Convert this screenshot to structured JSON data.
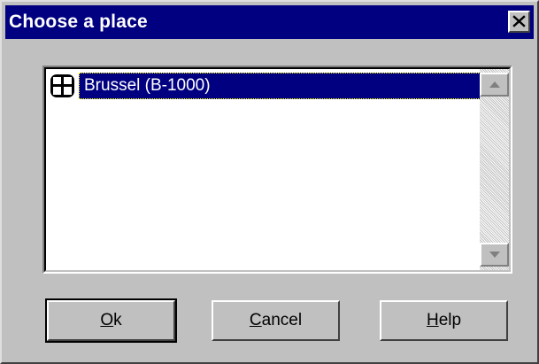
{
  "window": {
    "title": "Choose a place",
    "close_glyph": "✕"
  },
  "list": {
    "items": [
      {
        "label": "Brussel (B-1000)",
        "icon": "grid-place-icon",
        "selected": true
      }
    ]
  },
  "buttons": {
    "ok": {
      "mnemonic": "O",
      "rest": "k"
    },
    "cancel": {
      "mnemonic": "C",
      "rest": "ancel"
    },
    "help": {
      "mnemonic": "H",
      "rest": "elp"
    }
  },
  "colors": {
    "titlebar": "#000080",
    "selection": "#000080",
    "face": "#c0c0c0"
  }
}
